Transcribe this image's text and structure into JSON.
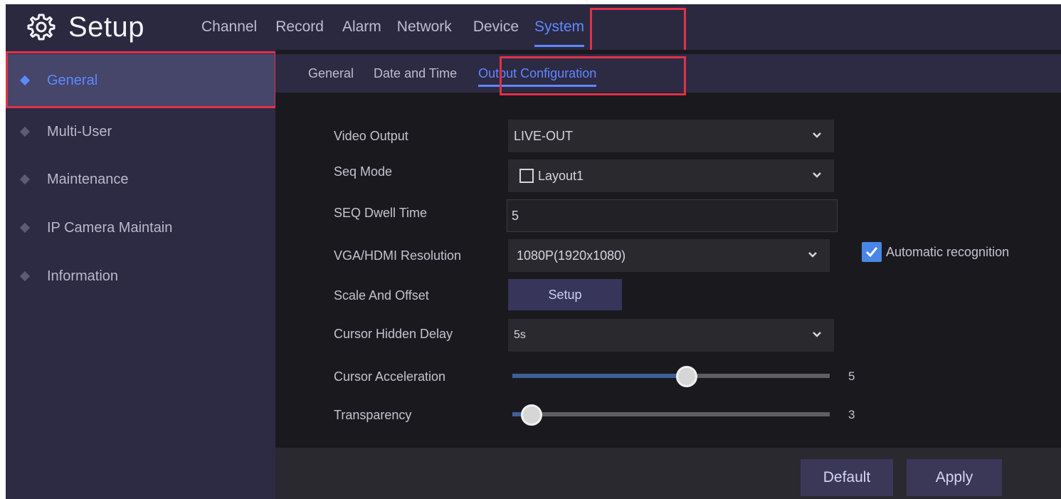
{
  "header": {
    "title": "Setup",
    "gear_icon": "gear-icon",
    "nav": [
      "Channel",
      "Record",
      "Alarm",
      "Network",
      "Device",
      "System"
    ],
    "active_nav": "System"
  },
  "sidebar": {
    "items": [
      {
        "label": "General",
        "active": true
      },
      {
        "label": "Multi-User",
        "active": false
      },
      {
        "label": "Maintenance",
        "active": false
      },
      {
        "label": "IP Camera Maintain",
        "active": false
      },
      {
        "label": "Information",
        "active": false
      }
    ]
  },
  "subtabs": {
    "items": [
      "General",
      "Date and Time",
      "Output Configuration"
    ],
    "active": "Output Configuration"
  },
  "form": {
    "video_output": {
      "label": "Video Output",
      "value": "LIVE-OUT"
    },
    "seq_mode": {
      "label": "Seq Mode",
      "value": "Layout1",
      "checked": false
    },
    "seq_dwell_time": {
      "label": "SEQ Dwell Time",
      "value": "5"
    },
    "vga_hdmi_resolution": {
      "label": "VGA/HDMI Resolution",
      "value": "1080P(1920x1080)"
    },
    "automatic_recognition": {
      "label": "Automatic recognition",
      "checked": true
    },
    "scale_and_offset": {
      "label": "Scale And Offset",
      "button": "Setup"
    },
    "cursor_hidden_delay": {
      "label": "Cursor Hidden Delay",
      "value": "5s"
    },
    "cursor_acceleration": {
      "label": "Cursor Acceleration",
      "value": "5",
      "fraction": 0.55
    },
    "transparency": {
      "label": "Transparency",
      "value": "3",
      "fraction": 0.06
    }
  },
  "footer": {
    "default_label": "Default",
    "apply_label": "Apply"
  },
  "colors": {
    "accent": "#5f88ff",
    "highlight_border": "#e0314a",
    "checkbox": "#4a86e8"
  }
}
